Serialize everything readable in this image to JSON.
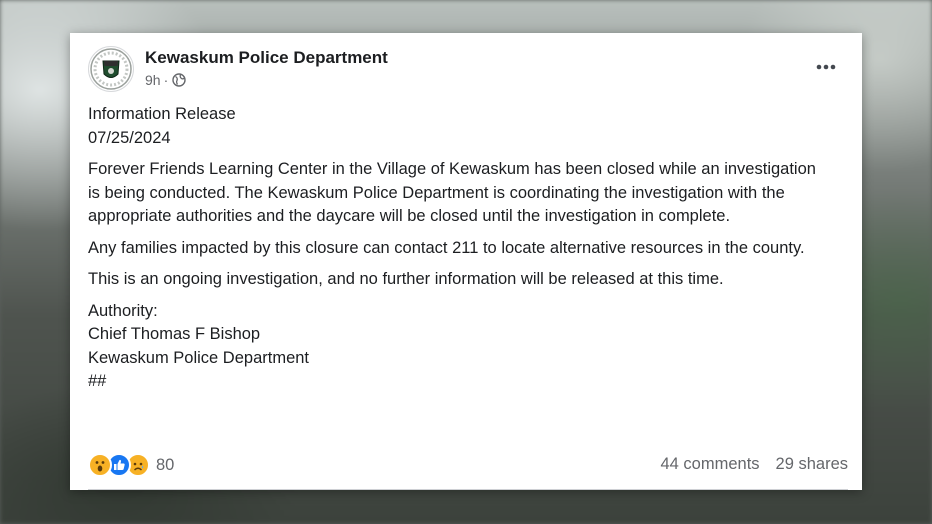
{
  "post": {
    "page_name": "Kewaskum Police Department",
    "time": "9h",
    "audience_icon": "globe-icon",
    "more_icon": "more-options-icon",
    "avatar_icon": "police-badge-logo",
    "header_line1": "Information Release",
    "header_line2": "07/25/2024",
    "paragraph1": "Forever Friends Learning Center in the Village of Kewaskum has been closed while an investigation is being conducted.  The Kewaskum Police Department is coordinating the investigation with the appropriate authorities and the daycare will be closed until the investigation in complete.",
    "paragraph2": "Any families impacted by this closure can contact 211 to locate alternative resources in the county.",
    "paragraph3": "This is an ongoing investigation, and no further information will be released at this time.",
    "authority_label": "Authority:",
    "authority_name": "Chief Thomas F Bishop",
    "authority_org": "Kewaskum Police Department",
    "end_mark": "##"
  },
  "footer": {
    "reaction_icons": [
      "wow-reaction-icon",
      "like-reaction-icon",
      "sad-reaction-icon"
    ],
    "reaction_count": "80",
    "comments": "44 comments",
    "shares": "29 shares"
  },
  "colors": {
    "text": "#1c1e21",
    "secondary_text": "#65676b",
    "like_blue": "#1877f2",
    "reaction_yellow": "#f7b125"
  }
}
